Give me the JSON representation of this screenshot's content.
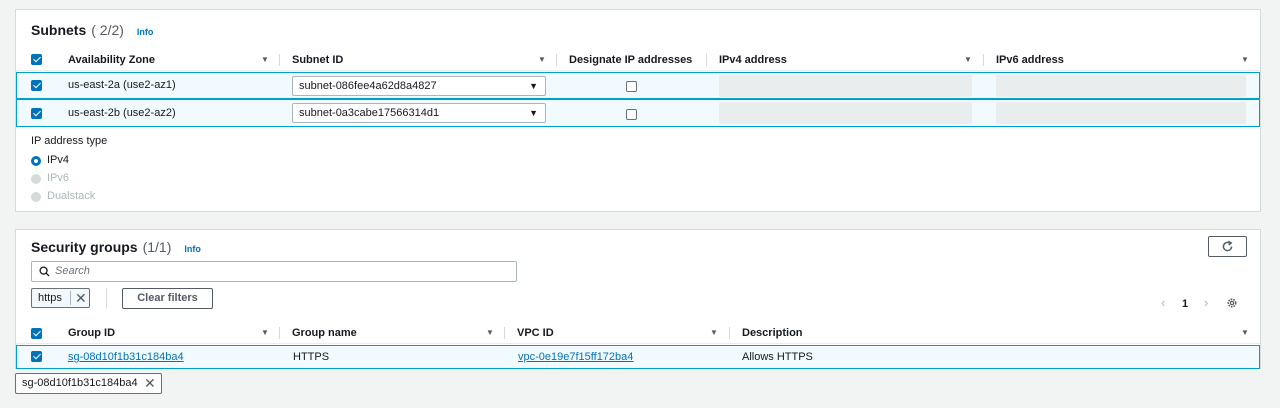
{
  "subnets": {
    "title": "Subnets",
    "count": "( 2/2)",
    "info": "Info",
    "columns": [
      "Availability Zone",
      "Subnet ID",
      "Designate IP addresses",
      "IPv4 address",
      "IPv6 address"
    ],
    "rows": [
      {
        "zone": "us-east-2a (use2-az1)",
        "subnet_id": "subnet-086fee4a62d8a4827",
        "designate": false
      },
      {
        "zone": "us-east-2b (use2-az2)",
        "subnet_id": "subnet-0a3cabe17566314d1",
        "designate": false
      }
    ],
    "ip_type": {
      "label": "IP address type",
      "options": [
        {
          "label": "IPv4",
          "selected": true,
          "enabled": true
        },
        {
          "label": "IPv6",
          "selected": false,
          "enabled": false
        },
        {
          "label": "Dualstack",
          "selected": false,
          "enabled": false
        }
      ]
    }
  },
  "security_groups": {
    "title": "Security groups",
    "count": "(1/1)",
    "info": "Info",
    "search_placeholder": "Search",
    "filter_token": "https",
    "clear_filters": "Clear filters",
    "page": "1",
    "columns": [
      "Group ID",
      "Group name",
      "VPC ID",
      "Description"
    ],
    "rows": [
      {
        "group_id": "sg-08d10f1b31c184ba4",
        "group_name": "HTTPS",
        "vpc_id": "vpc-0e19e7f15ff172ba4",
        "description": "Allows HTTPS"
      }
    ],
    "selected_token": "sg-08d10f1b31c184ba4"
  },
  "icons": {
    "search": "search-icon",
    "refresh": "refresh-icon",
    "settings": "gear-icon",
    "prev": "chevron-left-icon",
    "next": "chevron-right-icon",
    "remove": "close-icon",
    "sort": "sort-caret-icon"
  },
  "colors": {
    "accent": "#0073bb",
    "selected_row_bg": "#f1faff",
    "selected_row_border": "#00a1c9"
  }
}
